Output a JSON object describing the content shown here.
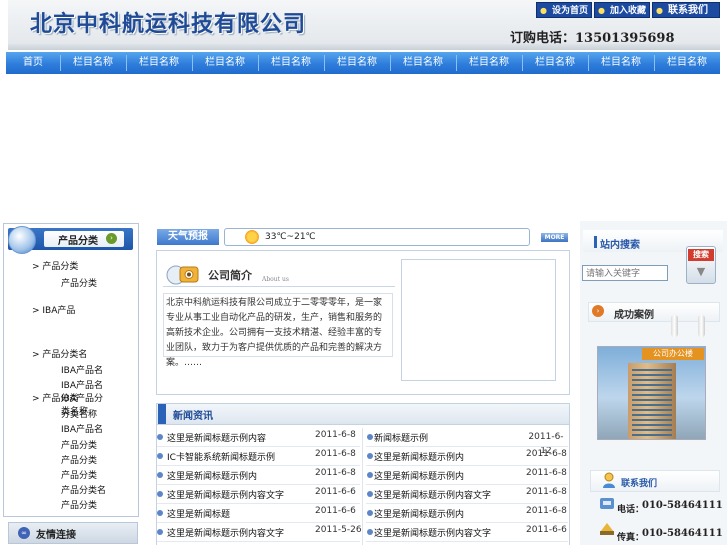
{
  "header": {
    "company_name": "北京中科航运科技有限公司",
    "top_links": [
      "设为首页",
      "加入收藏",
      "联系我们"
    ],
    "phone": "订购电话：13501395698"
  },
  "nav": {
    "items": [
      "首页",
      "栏目名称",
      "栏目名称",
      "栏目名称",
      "栏目名称",
      "栏目名称",
      "栏目名称",
      "栏目名称",
      "栏目名称",
      "栏目名称",
      "栏目名称"
    ]
  },
  "left": {
    "category_title": "产品分类",
    "categories": [
      {
        "label": "> 产品分类",
        "sub": [
          "产品分类"
        ]
      },
      {
        "label": "> IBA产品",
        "sub": []
      },
      {
        "label": "> 产品分类名",
        "sub": [
          "IBA产品名",
          "IBA产品名",
          "IBA产品分类名称",
          "IBA产品名"
        ]
      },
      {
        "label": "> 产品分类",
        "sub": [
          "分类名称",
          "产品分类",
          "产品分类",
          "产品分类",
          "产品分类名",
          "产品分类"
        ]
      }
    ],
    "friends_title": "友情连接"
  },
  "weather": {
    "label": "天气预报",
    "temp": "33℃~21℃",
    "more": "MORE"
  },
  "intro": {
    "title": "公司简介",
    "subtitle": "About us",
    "text": "北京中科航运科技有限公司成立于二零零零年，是一家专业从事工业自动化产品的研发，生产，销售和服务的高新技术企业。公司拥有一支技术精湛、经验丰富的专业团队，致力于为客户提供优质的产品和完善的解决方案。……"
  },
  "news": {
    "title": "新闻资讯",
    "left": [
      {
        "title": "这里是新闻标题示例内容",
        "date": "2011-6-8"
      },
      {
        "title": "IC卡智能系统新闻标题示例",
        "date": "2011-6-8"
      },
      {
        "title": "这里是新闻标题示例内",
        "date": "2011-6-8"
      },
      {
        "title": "这里是新闻标题示例内容文字",
        "date": "2011-6-6"
      },
      {
        "title": "这里是新闻标题",
        "date": "2011-6-6"
      },
      {
        "title": "这里是新闻标题示例内容文字",
        "date": "2011-5-26"
      }
    ],
    "right": [
      {
        "title": "新闻标题示例",
        "date": "2011-6-12"
      },
      {
        "title": "这里是新闻标题示例内",
        "date": "2011-6-8"
      },
      {
        "title": "这里是新闻标题示例内",
        "date": "2011-6-8"
      },
      {
        "title": "这里是新闻标题示例内容文字",
        "date": "2011-6-8"
      },
      {
        "title": "这里是新闻标题示例内",
        "date": "2011-6-8"
      },
      {
        "title": "这里是新闻标题示例内容文字",
        "date": "2011-6-6"
      }
    ]
  },
  "right": {
    "search_title": "站内搜索",
    "search_placeholder": "请输入关键字",
    "search_button": "搜索",
    "cases_title": "成功案例",
    "case_image_caption": "公司办公楼",
    "contact_title": "联系我们",
    "phone_label": "电话：",
    "phone_value": "010-58464111",
    "fax_label": "传真：",
    "fax_value": "010-58464111"
  },
  "colors": {
    "nav": "#2e7ddb",
    "brand": "#1e4a96",
    "accent_red": "#d23c2f"
  }
}
